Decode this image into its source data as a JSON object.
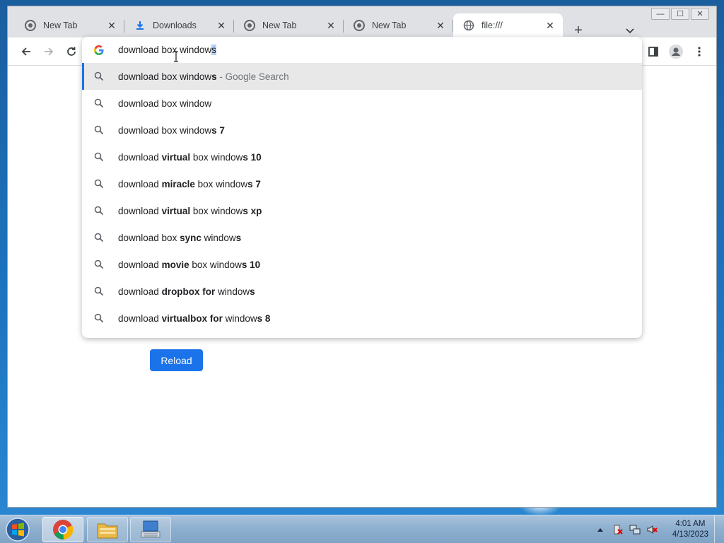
{
  "browser": {
    "tabs": [
      {
        "label": "New Tab",
        "icon": "chrome-icon"
      },
      {
        "label": "Downloads",
        "icon": "download-icon"
      },
      {
        "label": "New Tab",
        "icon": "chrome-icon"
      },
      {
        "label": "New Tab",
        "icon": "chrome-icon"
      },
      {
        "label": "file:///",
        "icon": "globe-icon",
        "active": true
      }
    ],
    "close_glyph": "✕",
    "new_tab_glyph": "+",
    "caption": {
      "minimize": "—",
      "maximize": "☐",
      "close": "✕"
    }
  },
  "omnibox": {
    "typed_prefix": "download box window",
    "selected_suffix": "s",
    "suggestions": [
      {
        "segments": [
          {
            "t": "download box window",
            "b": false
          },
          {
            "t": "s",
            "b": true
          }
        ],
        "sub": " - Google Search",
        "highlighted": true
      },
      {
        "segments": [
          {
            "t": "download box window",
            "b": false
          }
        ],
        "sub": ""
      },
      {
        "segments": [
          {
            "t": "download box window",
            "b": false
          },
          {
            "t": "s 7",
            "b": true
          }
        ],
        "sub": ""
      },
      {
        "segments": [
          {
            "t": "download ",
            "b": false
          },
          {
            "t": "virtual",
            "b": true
          },
          {
            "t": " box window",
            "b": false
          },
          {
            "t": "s 10",
            "b": true
          }
        ],
        "sub": ""
      },
      {
        "segments": [
          {
            "t": "download ",
            "b": false
          },
          {
            "t": "miracle",
            "b": true
          },
          {
            "t": " box window",
            "b": false
          },
          {
            "t": "s 7",
            "b": true
          }
        ],
        "sub": ""
      },
      {
        "segments": [
          {
            "t": "download ",
            "b": false
          },
          {
            "t": "virtual",
            "b": true
          },
          {
            "t": " box window",
            "b": false
          },
          {
            "t": "s xp",
            "b": true
          }
        ],
        "sub": ""
      },
      {
        "segments": [
          {
            "t": "download box ",
            "b": false
          },
          {
            "t": "sync",
            "b": true
          },
          {
            "t": " window",
            "b": false
          },
          {
            "t": "s",
            "b": true
          }
        ],
        "sub": ""
      },
      {
        "segments": [
          {
            "t": "download ",
            "b": false
          },
          {
            "t": "movie",
            "b": true
          },
          {
            "t": " box window",
            "b": false
          },
          {
            "t": "s 10",
            "b": true
          }
        ],
        "sub": ""
      },
      {
        "segments": [
          {
            "t": "download ",
            "b": false
          },
          {
            "t": "dropbox for",
            "b": true
          },
          {
            "t": " window",
            "b": false
          },
          {
            "t": "s",
            "b": true
          }
        ],
        "sub": ""
      },
      {
        "segments": [
          {
            "t": "download ",
            "b": false
          },
          {
            "t": "virtualbox for",
            "b": true
          },
          {
            "t": " window",
            "b": false
          },
          {
            "t": "s 8",
            "b": true
          }
        ],
        "sub": ""
      }
    ]
  },
  "page": {
    "reload_label": "Reload"
  },
  "taskbar": {
    "clock_time": "4:01 AM",
    "clock_date": "4/13/2023"
  },
  "colors": {
    "accent": "#1a73e8",
    "selection": "#b4d0f4",
    "highlight_row": "#e8e8e9"
  }
}
